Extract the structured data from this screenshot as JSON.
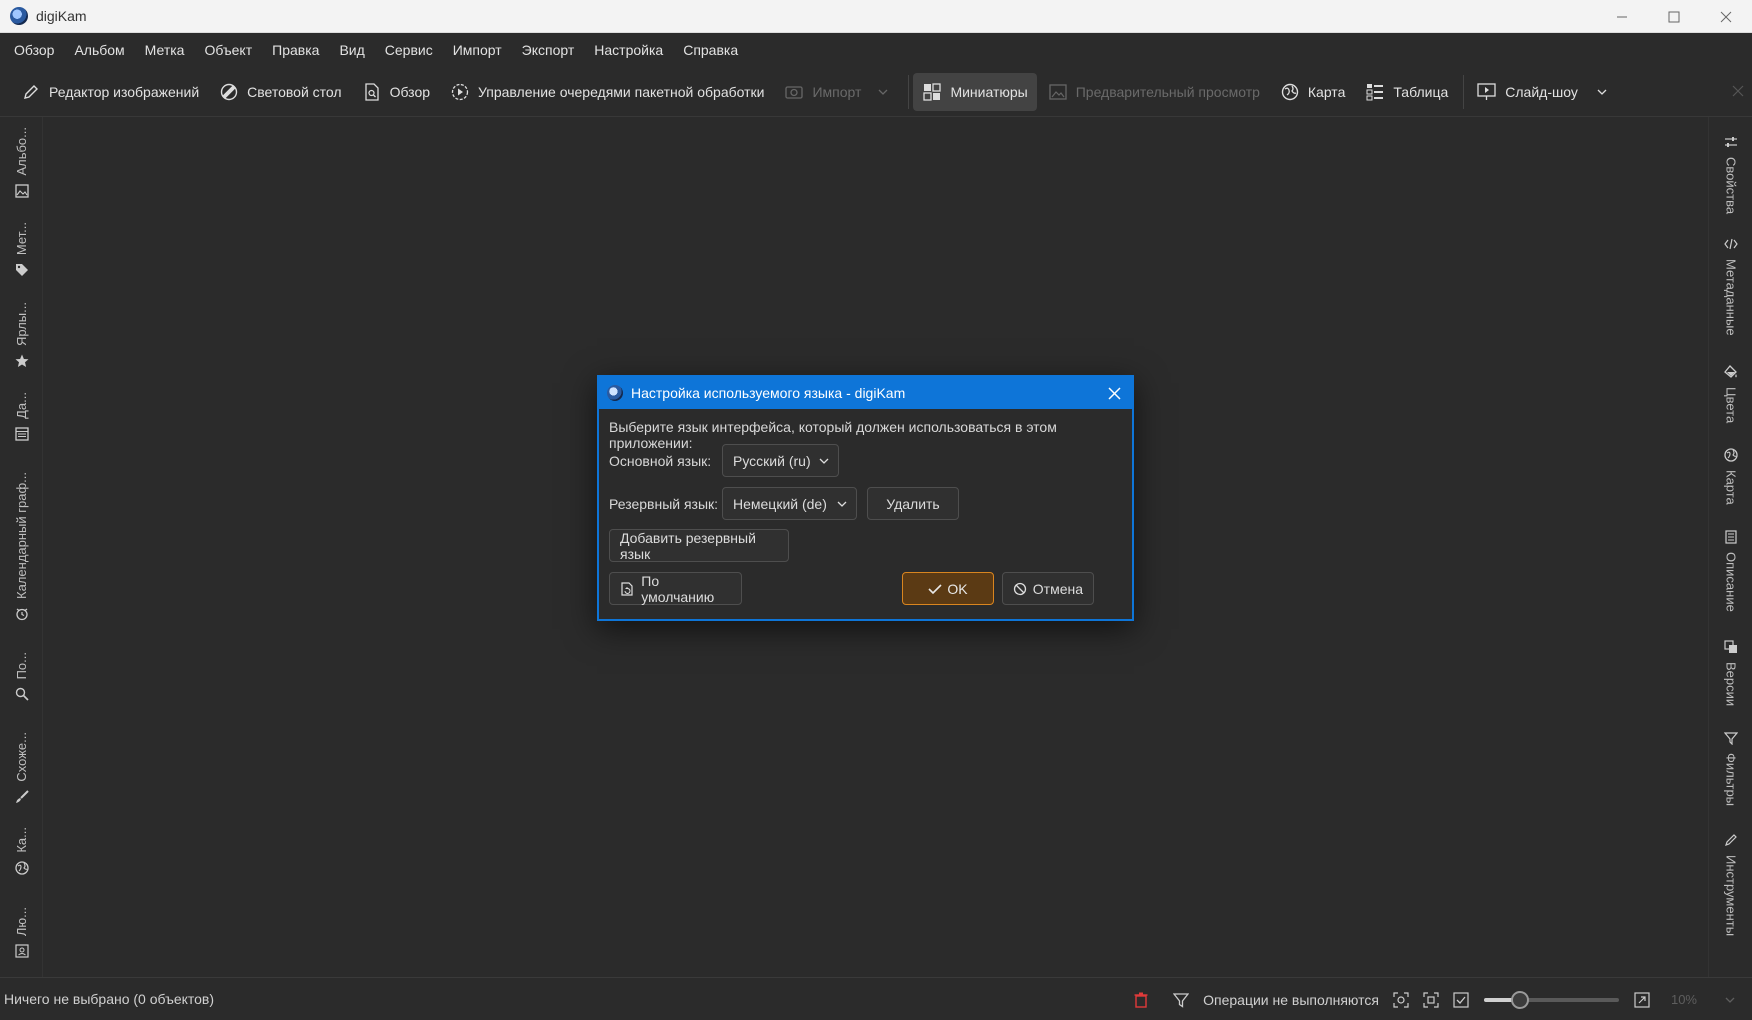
{
  "window": {
    "title": "digiKam",
    "controls": {
      "minimize": "—",
      "maximize": "☐",
      "close": "✕"
    }
  },
  "menu": [
    "Обзор",
    "Альбом",
    "Метка",
    "Объект",
    "Правка",
    "Вид",
    "Сервис",
    "Импорт",
    "Экспорт",
    "Настройка",
    "Справка"
  ],
  "toolbar": {
    "image_editor": "Редактор изображений",
    "light_table": "Световой стол",
    "browse": "Обзор",
    "batch_queue": "Управление очередями пакетной обработки",
    "import": "Импорт",
    "thumbnails": "Миниатюры",
    "preview": "Предварительный просмотр",
    "map": "Карта",
    "table": "Таблица",
    "slideshow": "Слайд-шоу"
  },
  "left_sidebar": [
    "Альбо...",
    "Мет...",
    "Ярлы...",
    "Да...",
    "Календарный граф...",
    "По...",
    "Схоже...",
    "Ка...",
    "Лю..."
  ],
  "right_sidebar": [
    "Свойства",
    "Метаданные",
    "Цвета",
    "Карта",
    "Описание",
    "Версии",
    "Фильтры",
    "Инструменты"
  ],
  "status": {
    "selection": "Ничего не выбрано (0 объектов)",
    "operations": "Операции не выполняются",
    "zoom": "10%",
    "zoom_slider_fraction": 0.27
  },
  "dialog": {
    "title": "Настройка используемого языка - digiKam",
    "prompt": "Выберите язык интерфейса, который должен использоваться в этом приложении:",
    "primary_label": "Основной язык:",
    "primary_value": "Русский (ru)",
    "fallback_label": "Резервный язык:",
    "fallback_value": "Немецкий (de)",
    "remove_button": "Удалить",
    "add_fallback_button": "Добавить резервный язык",
    "defaults_button": "По умолчанию",
    "ok_button": "OK",
    "cancel_button": "Отмена"
  },
  "colors": {
    "dialog_accent": "#0e75d8",
    "ok_border": "#d9851f",
    "trash_red": "#e03a3a"
  }
}
